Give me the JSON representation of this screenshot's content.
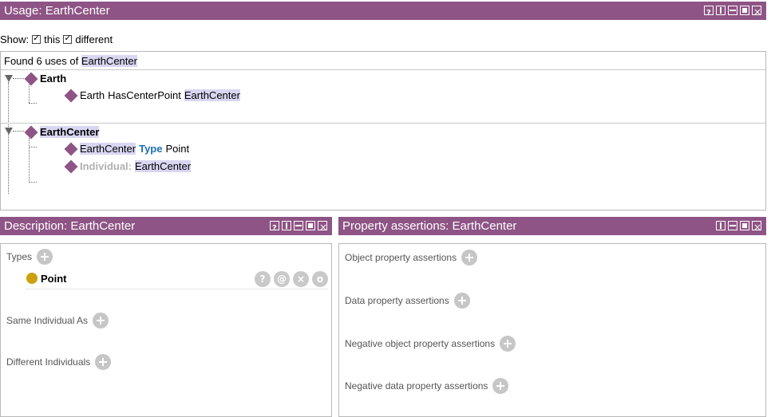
{
  "usage": {
    "title": "Usage: EarthCenter",
    "show_label": "Show:",
    "opt_this": "this",
    "opt_different": "different",
    "found_prefix": "Found 6 uses of",
    "found_entity": "EarthCenter",
    "groups": [
      {
        "header": "Earth",
        "items": [
          {
            "subject": "Earth",
            "middle": "HasCenterPoint",
            "object": "EarthCenter"
          }
        ]
      },
      {
        "header": "EarthCenter",
        "items": [
          {
            "subject": "EarthCenter",
            "keyword": "Type",
            "object": "Point"
          },
          {
            "keyword": "Individual:",
            "object": "EarthCenter"
          }
        ]
      }
    ]
  },
  "description": {
    "title": "Description: EarthCenter",
    "types_label": "Types",
    "type_value": "Point",
    "type_buttons": [
      "?",
      "@",
      "×",
      "o"
    ],
    "same_label": "Same Individual As",
    "different_label": "Different Individuals"
  },
  "property": {
    "title": "Property assertions: EarthCenter",
    "sections": [
      "Object property assertions",
      "Data property assertions",
      "Negative object property assertions",
      "Negative data property assertions"
    ]
  },
  "colors": {
    "titlebar": "#8e5485",
    "highlight": "#d9d6f2",
    "keyword": "#1e6eb4",
    "class_icon": "#caa10b",
    "individual_icon": "#8e5485"
  }
}
